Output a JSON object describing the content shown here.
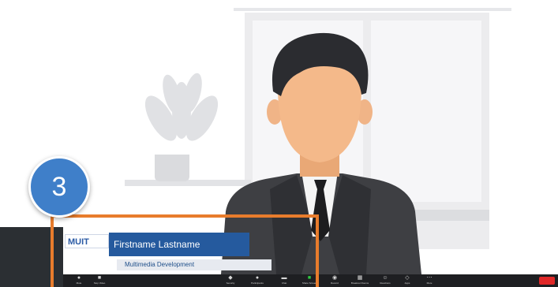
{
  "step": {
    "number": "3"
  },
  "lower_third": {
    "org": "MUIT",
    "name": "Firstname Lastname",
    "subtitle": "Multimedia Development"
  },
  "toolbar": {
    "items": [
      {
        "icon": "microphone-icon",
        "label": "Mute"
      },
      {
        "icon": "video-camera-icon",
        "label": "Stop Video"
      },
      {
        "icon": "security-icon",
        "label": "Security"
      },
      {
        "icon": "participants-icon",
        "label": "Participants"
      },
      {
        "icon": "chat-icon",
        "label": "Chat"
      },
      {
        "icon": "share-screen-icon",
        "label": "Share Screen"
      },
      {
        "icon": "record-icon",
        "label": "Record"
      },
      {
        "icon": "breakout-rooms-icon",
        "label": "Breakout Rooms"
      },
      {
        "icon": "reactions-icon",
        "label": "Reactions"
      },
      {
        "icon": "apps-icon",
        "label": "Apps"
      },
      {
        "icon": "more-icon",
        "label": "More"
      }
    ],
    "end_label": ""
  },
  "colors": {
    "highlight": "#e87c2c",
    "badge": "#3f7fc9",
    "banner": "#255a9e",
    "toolbar": "#1e1f22"
  }
}
